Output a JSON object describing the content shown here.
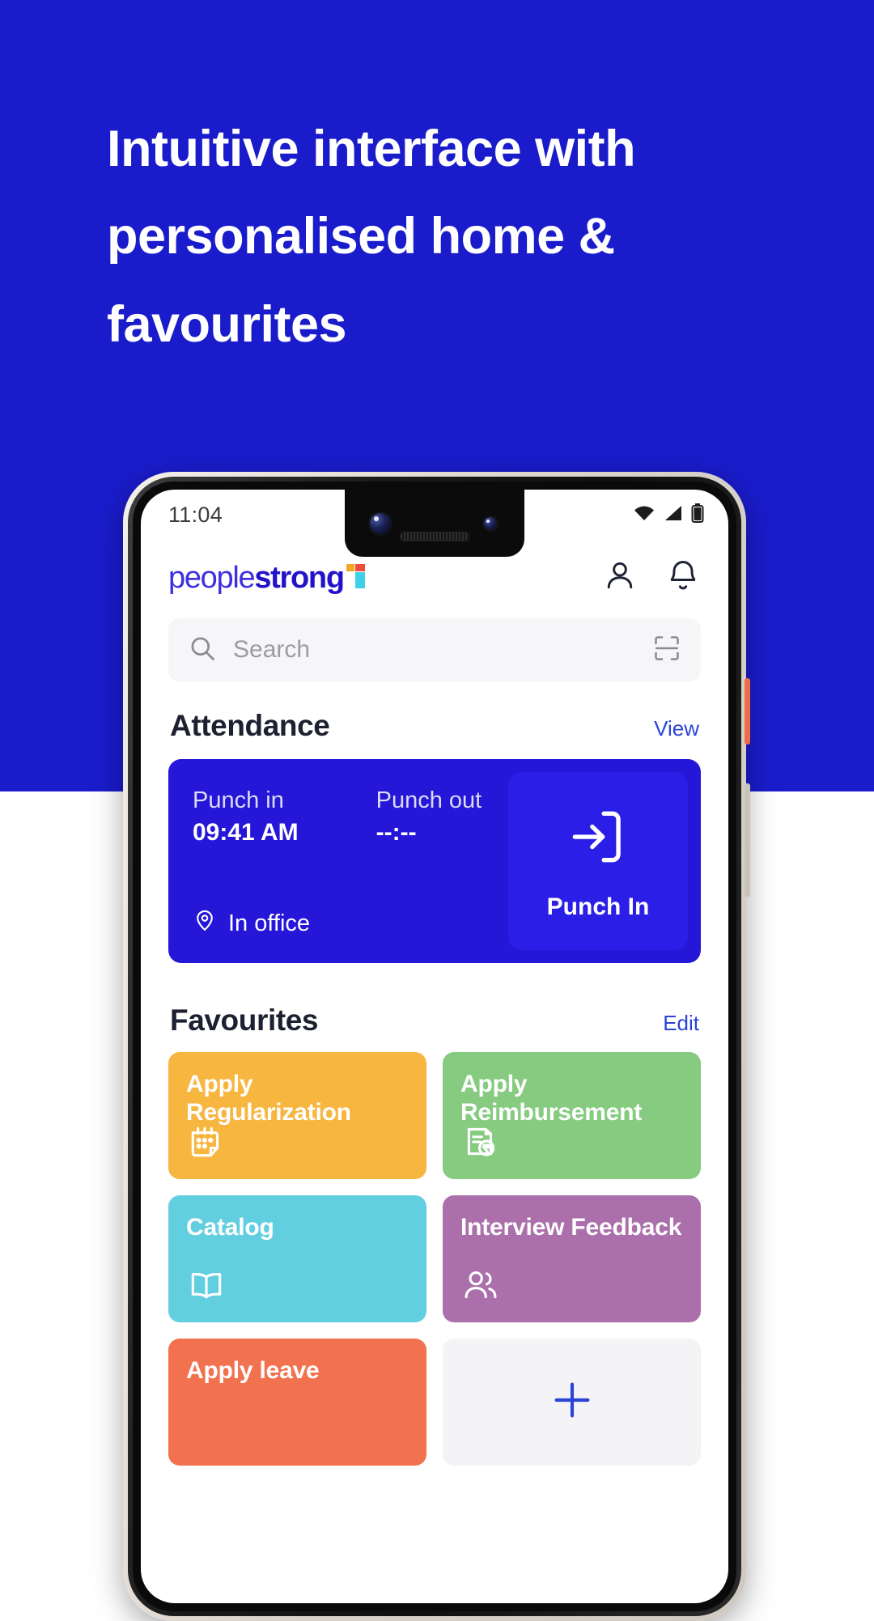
{
  "promo": {
    "headline": "Intuitive interface with personalised home & favourites",
    "bg_color": "#1a1ccc",
    "text_color": "#ffffff"
  },
  "status_bar": {
    "time": "11:04",
    "icons": [
      "wifi-icon",
      "signal-icon",
      "battery-icon"
    ]
  },
  "app": {
    "logo": {
      "light": "people",
      "bold": "strong"
    },
    "header_icons": [
      "profile-icon",
      "bell-icon"
    ],
    "search": {
      "placeholder": "Search",
      "scan_icon": "scan-icon"
    },
    "attendance": {
      "title": "Attendance",
      "action": "View",
      "punch_in_label": "Punch in",
      "punch_in_value": "09:41 AM",
      "punch_out_label": "Punch out",
      "punch_out_value": "--:--",
      "location": "In office",
      "button_label": "Punch In",
      "card_color": "#2516d8"
    },
    "favourites": {
      "title": "Favourites",
      "action": "Edit",
      "tiles": [
        {
          "label": "Apply Regularization",
          "color": "#f7b63f",
          "icon": "calendar-edit-icon"
        },
        {
          "label": "Apply Reimbursement",
          "color": "#86cb80",
          "icon": "receipt-rupee-icon"
        },
        {
          "label": "Catalog",
          "color": "#62cfe0",
          "icon": "book-icon"
        },
        {
          "label": "Interview Feedback",
          "color": "#ab70ab",
          "icon": "people-icon"
        },
        {
          "label": "Apply leave",
          "color": "#f2714e",
          "icon": ""
        }
      ],
      "add_tile": {
        "icon": "plus-icon",
        "color": "#f4f4f7"
      }
    }
  }
}
